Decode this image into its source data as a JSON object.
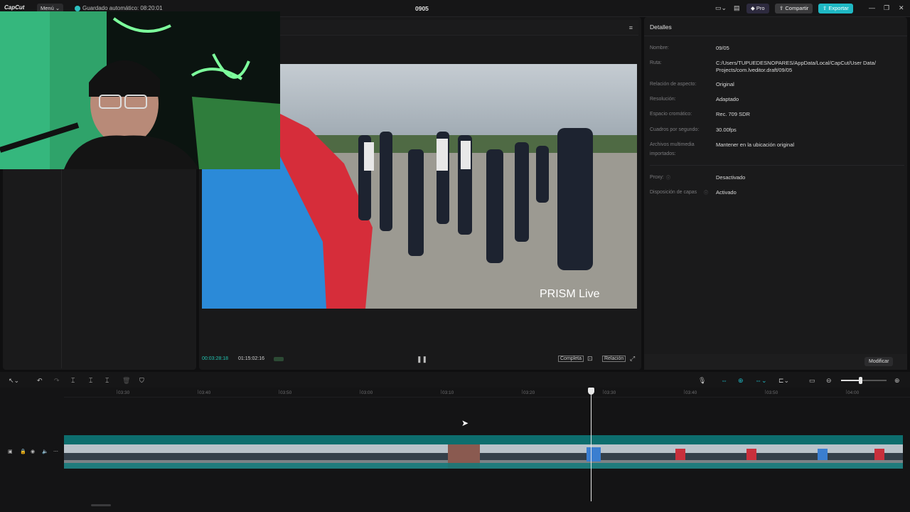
{
  "topbar": {
    "logo": "CapCut",
    "menu_label": "Menú",
    "autosave": "Guardado automático: 08:20:01",
    "project_title": "0905",
    "pro_label": "Pro",
    "share_label": "Compartir",
    "export_label": "Exportar"
  },
  "preview": {
    "current_time": "00:03:28:18",
    "total_time": "01:15:02:16",
    "full_label": "Completa",
    "ratio_label": "Relación",
    "watermark": "PRISM Live"
  },
  "details": {
    "title": "Detalles",
    "rows": [
      {
        "label": "Nombre:",
        "value": "09/05"
      },
      {
        "label": "Ruta:",
        "value": "C:/Users/TUPUEDESNOPARES/AppData/Local/CapCut/User Data/",
        "value2": "Projects/com.lveditor.draft/09/05"
      },
      {
        "label": "Relación de aspecto:",
        "value": "Original"
      },
      {
        "label": "Resolución:",
        "value": "Adaptado"
      },
      {
        "label": "Espacio cromático:",
        "value": "Rec. 709 SDR"
      },
      {
        "label": "Cuadros por segundo:",
        "value": "30.00fps"
      },
      {
        "label": "Archivos multimedia",
        "label2": "importados:",
        "value": "Mantener en la ubicación original"
      },
      {
        "label": "Proxy:",
        "value": "Desactivado"
      },
      {
        "label": "Disposición de capas",
        "value": "Activado"
      }
    ],
    "modify_label": "Modificar"
  },
  "timeline": {
    "ticks": [
      "03:30",
      "03:40",
      "03:50",
      "03:00",
      "03:10",
      "03:20",
      "03:30",
      "03:40",
      "03:50",
      "04:00"
    ]
  },
  "colors": {
    "accent": "#1fb8c4",
    "clip": "#0f7a7a",
    "time_green": "#22c3b0"
  }
}
